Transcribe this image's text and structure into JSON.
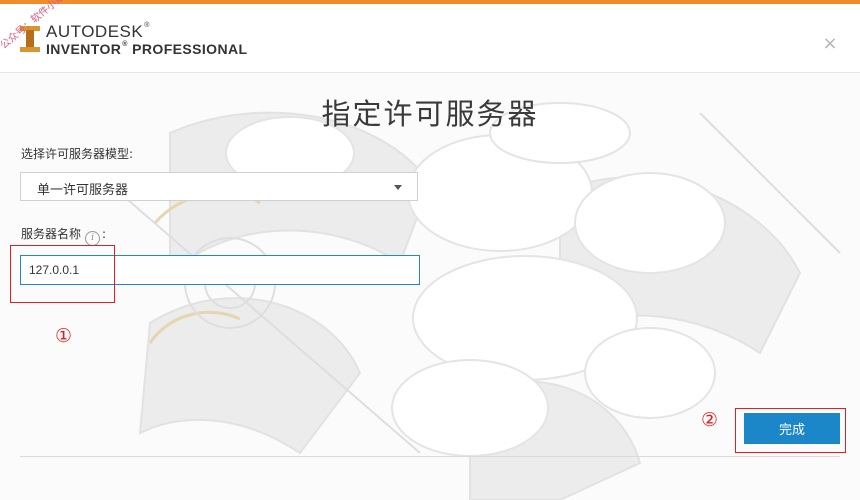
{
  "header": {
    "brand_line1": "AUTODESK",
    "brand_line2": "INVENTOR",
    "brand_line2b": "PROFESSIONAL",
    "registered_mark": "®",
    "close_glyph": "×",
    "watermark": "公众号：软件小站"
  },
  "main": {
    "title": "指定许可服务器",
    "model_label": "选择许可服务器模型:",
    "model_select": {
      "value": "单一许可服务器"
    },
    "server_label": "服务器名称",
    "server_label_colon": ":",
    "server_input": {
      "value": "127.0.0.1"
    },
    "info_icon_glyph": "i"
  },
  "annotations": {
    "marker1": "①",
    "marker2": "②"
  },
  "footer": {
    "finish_label": "完成"
  },
  "colors": {
    "accent": "#f28c28",
    "primary_button": "#1b87c9",
    "annotation_red": "#e02020",
    "input_focus_border": "#1f8acb"
  },
  "icons": {
    "logo": "inventor-logo-icon",
    "close": "close-icon",
    "info": "info-icon",
    "dropdown": "chevron-down-icon"
  }
}
